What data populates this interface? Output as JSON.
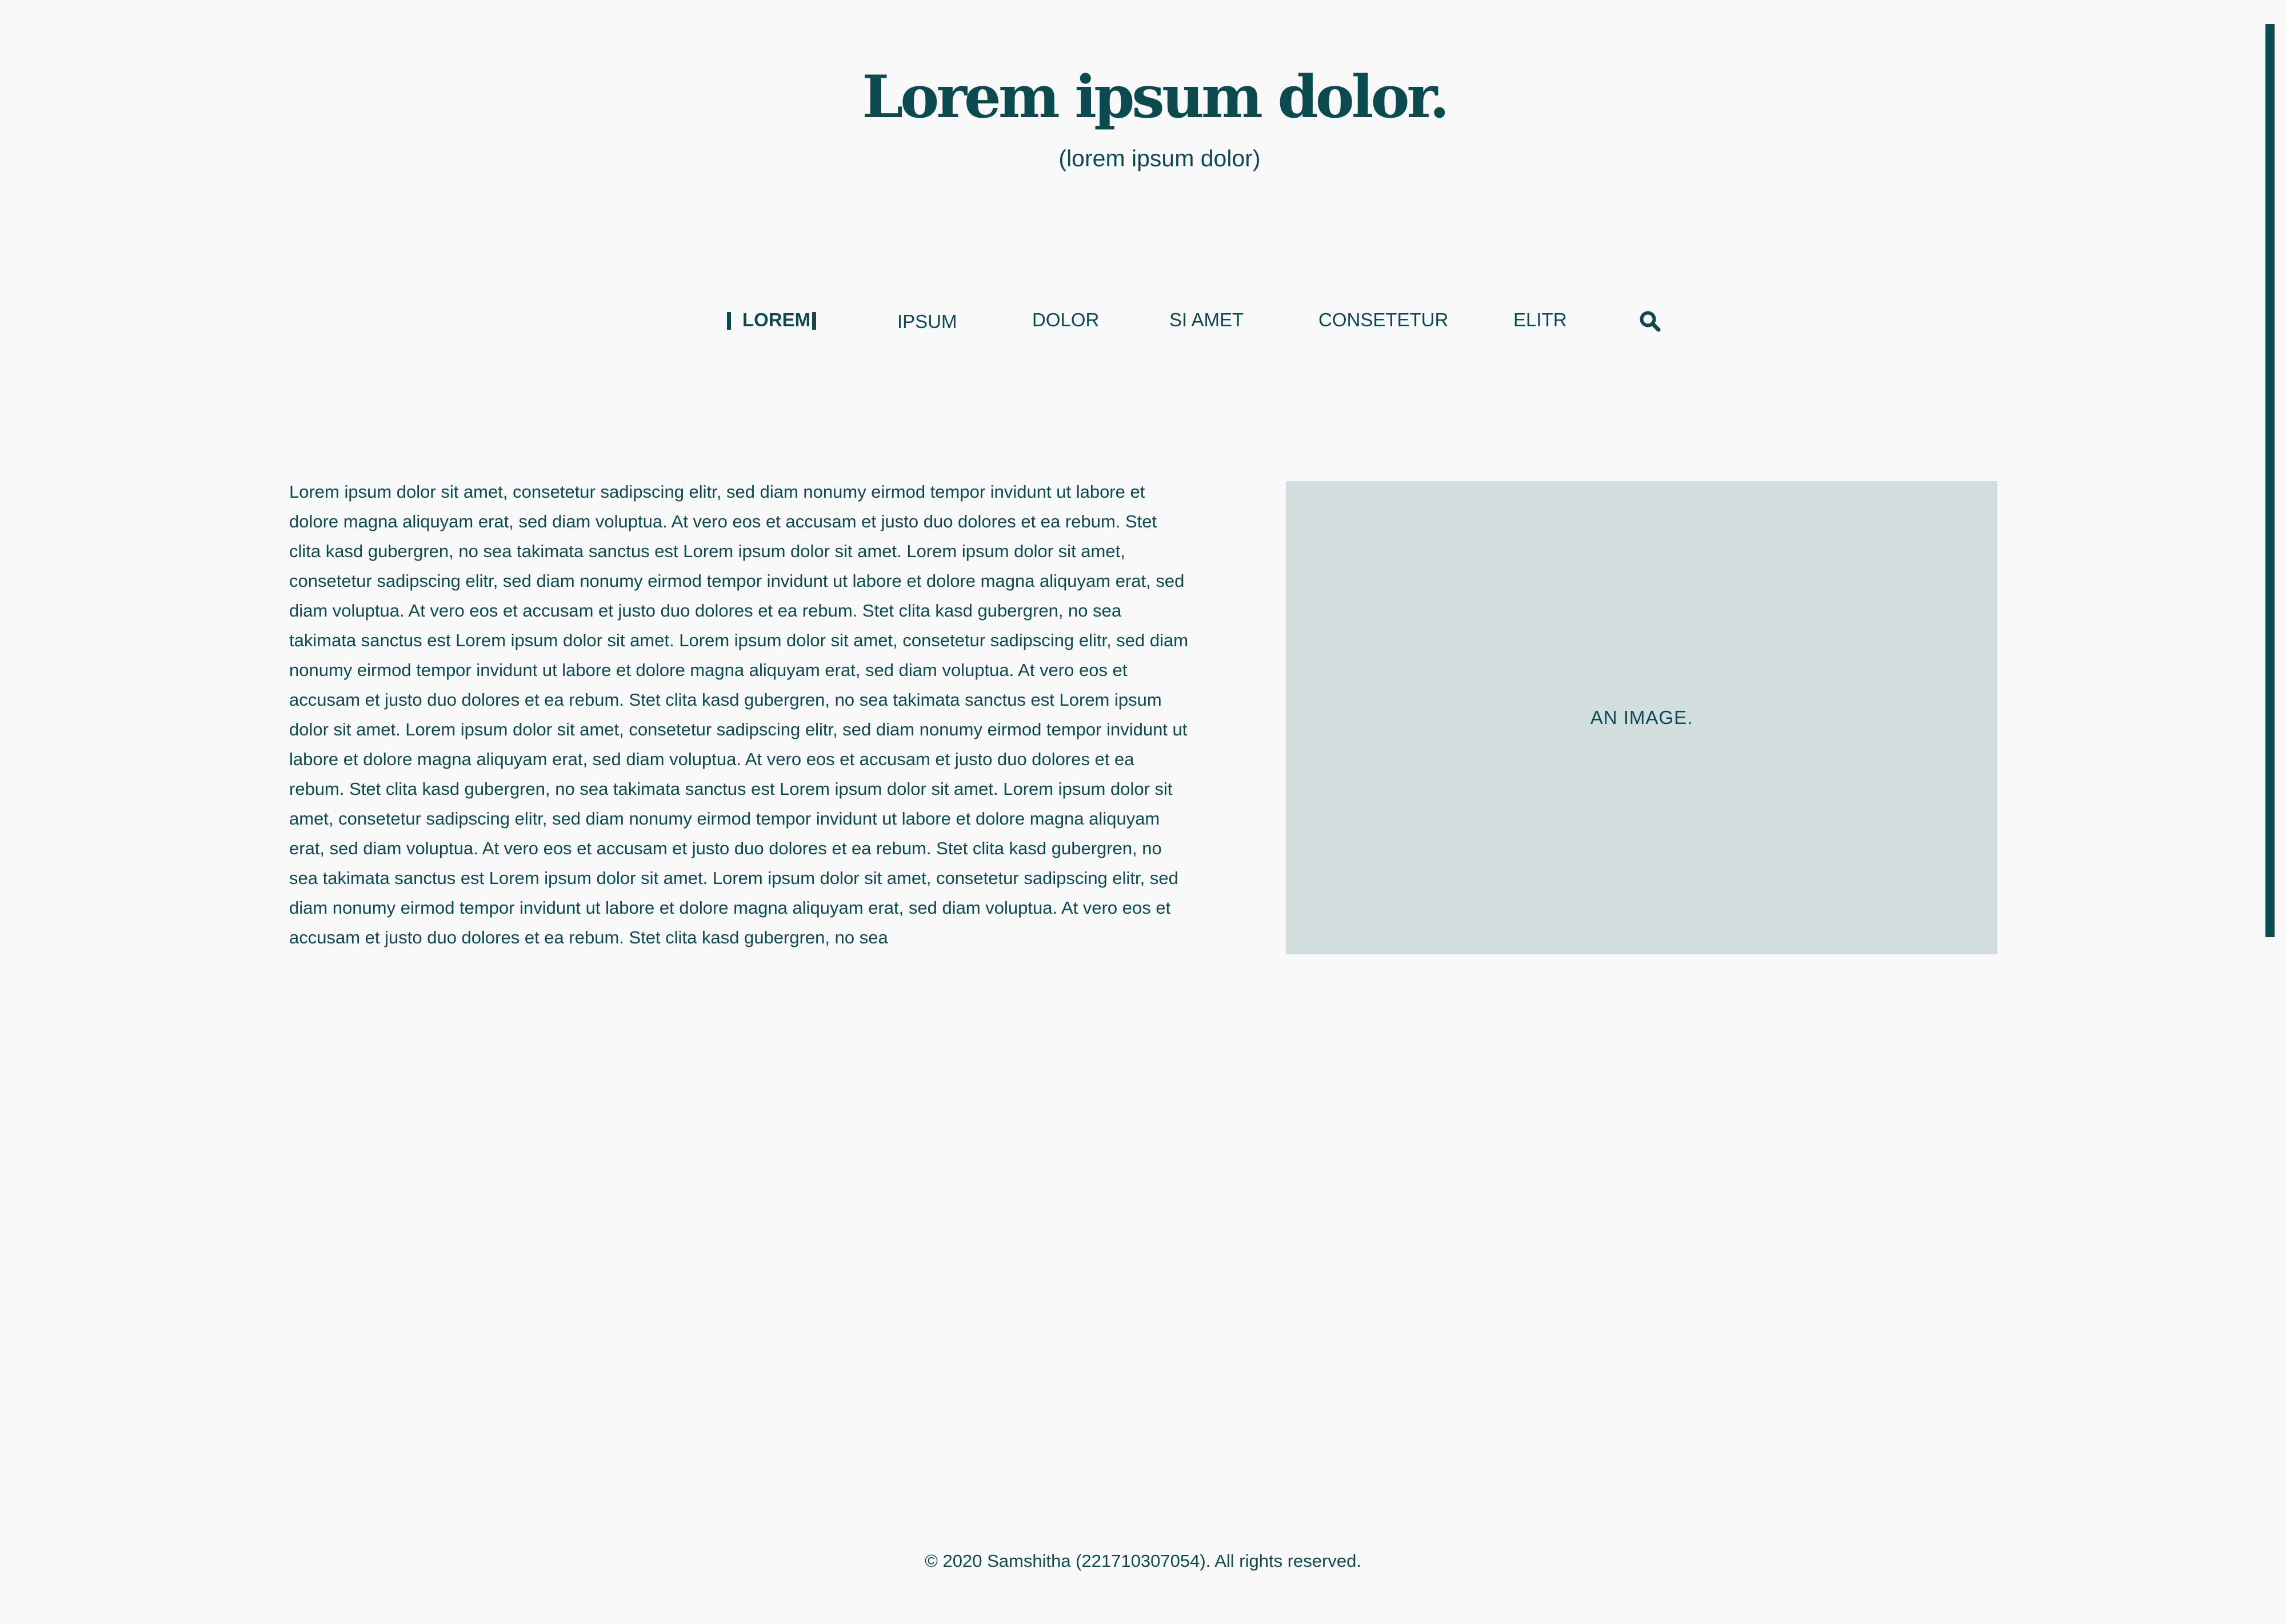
{
  "header": {
    "title": "Lorem ipsum dolor.",
    "subtitle": "(lorem ipsum dolor)"
  },
  "nav": {
    "items": [
      {
        "label": "LOREM",
        "active": true
      },
      {
        "label": "IPSUM",
        "active": false
      },
      {
        "label": "DOLOR",
        "active": false
      },
      {
        "label": "SI AMET",
        "active": false
      },
      {
        "label": "CONSETETUR",
        "active": false
      },
      {
        "label": "ELITR",
        "active": false
      }
    ],
    "search_icon": "search-icon"
  },
  "main": {
    "text": "Lorem ipsum dolor sit amet, consetetur sadipscing elitr, sed diam nonumy eirmod tempor invidunt ut labore et dolore magna aliquyam erat, sed diam voluptua. At vero eos et accusam et justo duo dolores et ea rebum. Stet clita kasd gubergren, no sea takimata sanctus est Lorem ipsum dolor sit amet. Lorem ipsum dolor sit amet, consetetur sadipscing elitr, sed diam nonumy eirmod tempor invidunt ut labore et dolore magna aliquyam erat, sed diam voluptua. At vero eos et accusam et justo duo dolores et ea rebum. Stet clita kasd gubergren, no sea takimata sanctus est Lorem ipsum dolor sit amet. Lorem ipsum dolor sit amet, consetetur sadipscing elitr, sed diam nonumy eirmod tempor invidunt ut labore et dolore magna aliquyam erat, sed diam voluptua. At vero eos et accusam et justo duo dolores et ea rebum. Stet clita kasd gubergren, no sea takimata sanctus est Lorem ipsum dolor sit amet. Lorem ipsum dolor sit amet, consetetur sadipscing elitr, sed diam nonumy eirmod tempor invidunt ut labore et dolore magna aliquyam erat, sed diam voluptua. At vero eos et accusam et justo duo dolores et ea rebum. Stet clita kasd gubergren, no sea takimata sanctus est Lorem ipsum dolor sit amet. Lorem ipsum dolor sit amet, consetetur sadipscing elitr, sed diam nonumy eirmod tempor invidunt ut labore et dolore magna aliquyam erat, sed diam voluptua. At vero eos et accusam et justo duo dolores et ea rebum. Stet clita kasd gubergren, no sea takimata sanctus est Lorem ipsum dolor sit amet. Lorem ipsum dolor sit amet, consetetur sadipscing elitr, sed diam nonumy eirmod tempor invidunt ut labore et dolore magna aliquyam erat, sed diam voluptua. At vero eos et accusam et justo duo dolores et ea rebum. Stet clita kasd gubergren, no sea",
    "image_label": "AN IMAGE."
  },
  "footer": {
    "text": "© 2020 Samshitha (221710307054). All rights reserved."
  },
  "colors": {
    "primary": "#0b4a4f",
    "background": "#f9f9f9",
    "image_placeholder": "#d2dede"
  }
}
